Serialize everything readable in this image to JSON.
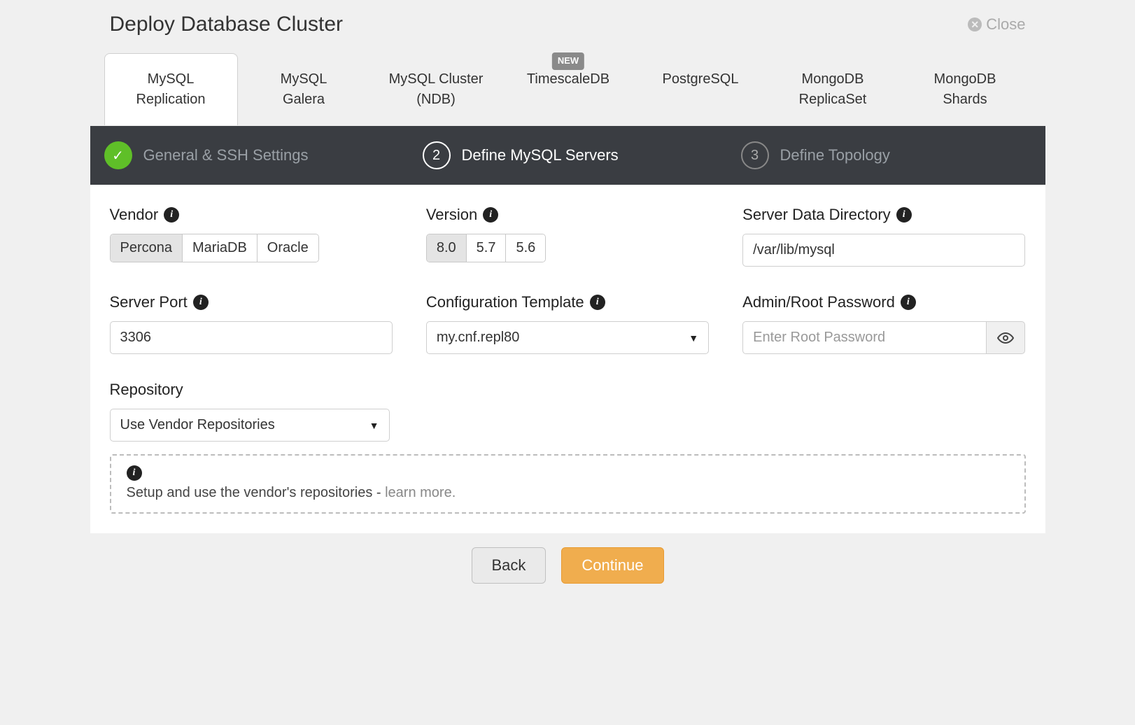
{
  "header": {
    "title": "Deploy Database Cluster",
    "close_label": "Close"
  },
  "tabs": [
    {
      "label1": "MySQL",
      "label2": "Replication",
      "active": true
    },
    {
      "label1": "MySQL",
      "label2": "Galera"
    },
    {
      "label1": "MySQL Cluster",
      "label2": "(NDB)"
    },
    {
      "label1": "TimescaleDB",
      "label2": "",
      "badge": "NEW"
    },
    {
      "label1": "PostgreSQL",
      "label2": ""
    },
    {
      "label1": "MongoDB",
      "label2": "ReplicaSet"
    },
    {
      "label1": "MongoDB",
      "label2": "Shards"
    }
  ],
  "steps": [
    {
      "label": "General & SSH Settings",
      "state": "done"
    },
    {
      "label": "Define MySQL Servers",
      "state": "current",
      "num": "2"
    },
    {
      "label": "Define Topology",
      "state": "pending",
      "num": "3"
    }
  ],
  "form": {
    "vendor": {
      "label": "Vendor",
      "options": [
        "Percona",
        "MariaDB",
        "Oracle"
      ],
      "selected": "Percona"
    },
    "version": {
      "label": "Version",
      "options": [
        "8.0",
        "5.7",
        "5.6"
      ],
      "selected": "8.0"
    },
    "data_dir": {
      "label": "Server Data Directory",
      "value": "/var/lib/mysql"
    },
    "port": {
      "label": "Server Port",
      "value": "3306"
    },
    "config_template": {
      "label": "Configuration Template",
      "value": "my.cnf.repl80"
    },
    "admin_pw": {
      "label": "Admin/Root Password",
      "placeholder": "Enter Root Password",
      "value": ""
    },
    "repository": {
      "label": "Repository",
      "value": "Use Vendor Repositories",
      "help_text": "Setup and use the vendor's repositories - ",
      "help_link": "learn more."
    }
  },
  "footer": {
    "back": "Back",
    "continue": "Continue"
  }
}
